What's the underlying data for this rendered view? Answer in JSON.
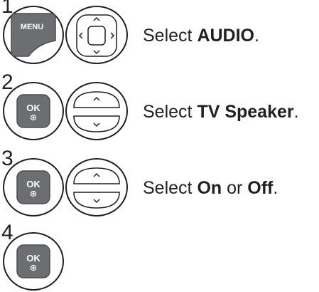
{
  "steps": [
    {
      "number": "1",
      "button": {
        "label": "MENU",
        "icon": "menu-key-icon"
      },
      "nav": {
        "icon": "four-way-navigation-icon"
      },
      "instruction": {
        "prefix": "Select ",
        "bold": "AUDIO",
        "suffix": "."
      }
    },
    {
      "number": "2",
      "button": {
        "label": "OK",
        "icon": "ok-key-icon"
      },
      "nav": {
        "icon": "up-down-navigation-icon"
      },
      "instruction": {
        "prefix": "Select ",
        "bold": "TV Speaker",
        "suffix": "."
      }
    },
    {
      "number": "3",
      "button": {
        "label": "OK",
        "icon": "ok-key-icon"
      },
      "nav": {
        "icon": "up-down-navigation-icon"
      },
      "instruction": {
        "prefix": "Select ",
        "bold": "On",
        "middle": " or ",
        "bold2": "Off",
        "suffix": "."
      }
    },
    {
      "number": "4",
      "button": {
        "label": "OK",
        "icon": "ok-key-icon"
      }
    }
  ],
  "colors": {
    "key_fill": "#6d6e71",
    "key_text": "#ffffff",
    "outline": "#231f20"
  }
}
